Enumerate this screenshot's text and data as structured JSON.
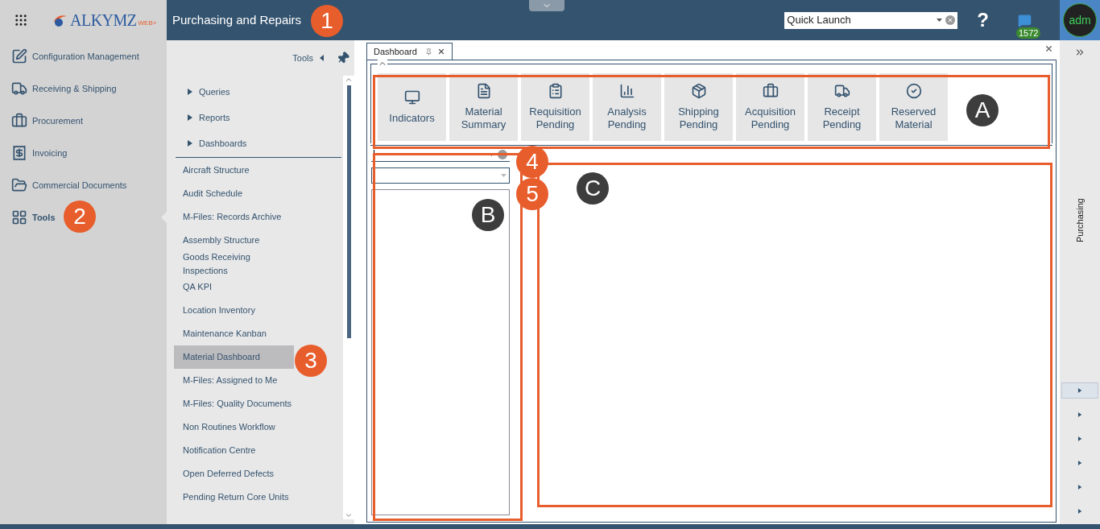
{
  "app": {
    "logo": "ALKYMZ",
    "logo_sub": "WEB+",
    "title": "Purchasing and Repairs"
  },
  "quick_launch": {
    "value": "Quick Launch"
  },
  "help": "?",
  "messages": {
    "count": "1572"
  },
  "user": {
    "initials": "adm"
  },
  "sidebar": {
    "items": [
      {
        "label": "Configuration Management",
        "selected": false
      },
      {
        "label": "Receiving & Shipping",
        "selected": false
      },
      {
        "label": "Procurement",
        "selected": false
      },
      {
        "label": "Invoicing",
        "selected": false
      },
      {
        "label": "Commercial Documents",
        "selected": false
      },
      {
        "label": "Tools",
        "selected": true
      }
    ]
  },
  "tools_panel": {
    "title": "Tools",
    "groups": [
      {
        "label": "Queries",
        "expanded": false
      },
      {
        "label": "Reports",
        "expanded": false
      },
      {
        "label": "Dashboards",
        "expanded": false
      }
    ],
    "items": [
      {
        "label": "Aircraft Structure",
        "selected": false
      },
      {
        "label": "Audit Schedule",
        "selected": false
      },
      {
        "label": "M-Files: Records Archive",
        "selected": false
      },
      {
        "label": "Assembly Structure",
        "selected": false
      },
      {
        "label": "Goods Receiving Inspections",
        "selected": false
      },
      {
        "label": "QA KPI",
        "selected": false
      },
      {
        "label": "Location Inventory",
        "selected": false
      },
      {
        "label": "Maintenance Kanban",
        "selected": false
      },
      {
        "label": "Material Dashboard",
        "selected": true
      },
      {
        "label": "M-Files: Assigned to Me",
        "selected": false
      },
      {
        "label": "M-Files: Quality Documents",
        "selected": false
      },
      {
        "label": "Non Routines Workflow",
        "selected": false
      },
      {
        "label": "Notification Centre",
        "selected": false
      },
      {
        "label": "Open Deferred Defects",
        "selected": false
      },
      {
        "label": "Pending Return Core Units",
        "selected": false
      }
    ]
  },
  "tabs": [
    {
      "label": "Dashboard",
      "selected": true
    }
  ],
  "tiles": [
    {
      "label": "Indicators"
    },
    {
      "label": "Material Summary"
    },
    {
      "label": "Requisition Pending"
    },
    {
      "label": "Analysis Pending"
    },
    {
      "label": "Shipping Pending"
    },
    {
      "label": "Acquisition Pending"
    },
    {
      "label": "Receipt Pending"
    },
    {
      "label": "Reserved Material"
    }
  ],
  "right_strip": {
    "label": "Purchasing",
    "buttons": [
      {
        "selected": true
      },
      {
        "selected": false
      },
      {
        "selected": false
      },
      {
        "selected": false
      },
      {
        "selected": false
      },
      {
        "selected": false
      }
    ]
  },
  "annotations": [
    {
      "label": "1",
      "kind": "number"
    },
    {
      "label": "2",
      "kind": "number"
    },
    {
      "label": "3",
      "kind": "number"
    },
    {
      "label": "4",
      "kind": "number"
    },
    {
      "label": "5",
      "kind": "number"
    },
    {
      "label": "A",
      "kind": "letter"
    },
    {
      "label": "B",
      "kind": "letter"
    },
    {
      "label": "C",
      "kind": "letter"
    }
  ]
}
